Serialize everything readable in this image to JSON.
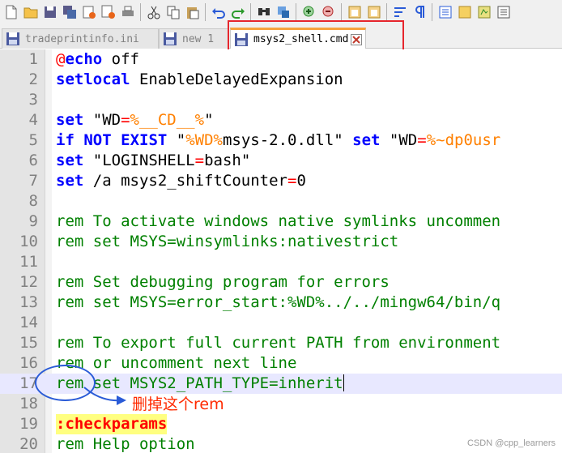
{
  "toolbar": {
    "icons": [
      "new-file-icon",
      "open-file-icon",
      "save-icon",
      "save-all-icon",
      "close-icon",
      "close-all-icon",
      "print-icon",
      "cut-icon",
      "copy-icon",
      "paste-icon",
      "undo-icon",
      "redo-icon",
      "find-icon",
      "replace-icon",
      "zoom-in-icon",
      "zoom-out-icon",
      "sync-vertical-icon",
      "sync-horizontal-icon",
      "word-wrap-icon",
      "show-all-chars-icon",
      "indent-guide-icon",
      "udl-icon",
      "doc-map-icon",
      "function-list-icon"
    ]
  },
  "tabs": [
    {
      "label": "tradeprintinfo.ini",
      "active": false
    },
    {
      "label": "new 1",
      "active": false
    },
    {
      "label": "msys2_shell.cmd",
      "active": true
    }
  ],
  "editor": {
    "line_numbers": [
      "1",
      "2",
      "3",
      "4",
      "5",
      "6",
      "7",
      "8",
      "9",
      "10",
      "11",
      "12",
      "13",
      "14",
      "15",
      "16",
      "17",
      "18",
      "19",
      "20"
    ],
    "lines": {
      "l1_at": "@",
      "l1_kw": "echo",
      "l1_rest": " off",
      "l2_kw": "setlocal",
      "l2_rest": " EnableDelayedExpansion",
      "l4_kw": "set",
      "l4_a": " \"WD",
      "l4_op": "=",
      "l4_var": "%__CD__%",
      "l4_b": "\"",
      "l5_kw1": "if",
      "l5_kw2": "NOT",
      "l5_kw3": "EXIST",
      "l5_a": " \"",
      "l5_var": "%WD%",
      "l5_b": "msys-2.0.dll\" ",
      "l5_kw4": "set",
      "l5_c": " \"WD",
      "l5_op": "=",
      "l5_var2": "%~dp0usr",
      "l6_kw": "set",
      "l6_a": " \"LOGINSHELL",
      "l6_op": "=",
      "l6_b": "bash\"",
      "l7_kw": "set",
      "l7_a": " /a msys2_shiftCounter",
      "l7_op": "=",
      "l7_b": "0",
      "l9": "rem To activate windows native symlinks uncommen",
      "l10": "rem set MSYS=winsymlinks:nativestrict",
      "l12": "rem Set debugging program for errors",
      "l13": "rem set MSYS=error_start:%WD%../../mingw64/bin/q",
      "l15": "rem To export full current PATH from environment",
      "l16": "rem or uncomment next line",
      "l17": "rem set MSYS2_PATH_TYPE=inherit",
      "l19": ":checkparams",
      "l20": "rem Help option"
    },
    "current_line": 17
  },
  "annotation": {
    "note": "删掉这个rem",
    "color": "#ff2a00",
    "circle_color": "#2a5bd7"
  },
  "watermark": "CSDN @cpp_learners"
}
